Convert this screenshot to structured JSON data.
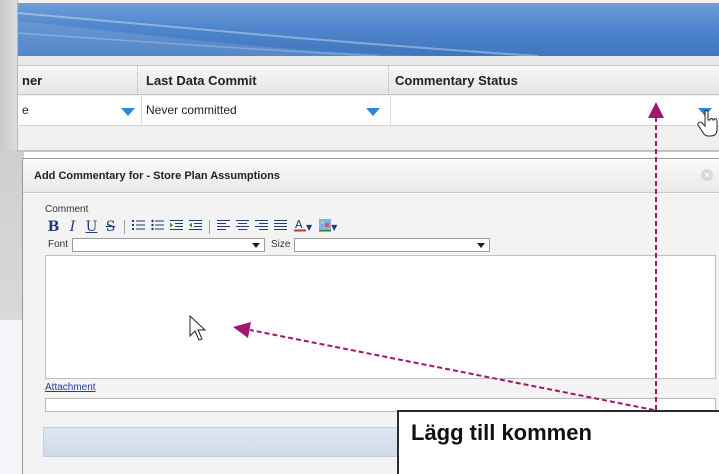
{
  "grid": {
    "columns": [
      "ner",
      "Last Data Commit",
      "Commentary Status"
    ],
    "row": [
      "e",
      "Never committed",
      ""
    ]
  },
  "dialog": {
    "title": "Add Commentary for - Store Plan Assumptions",
    "close_icon": "close-icon",
    "comment_label": "Comment",
    "toolbar": {
      "bold": "B",
      "italic": "I",
      "underline": "U",
      "strike": "S",
      "icons": [
        "ordered-list-icon",
        "unordered-list-icon",
        "indent-icon",
        "outdent-icon",
        "align-left-icon",
        "align-center-icon",
        "align-right-icon",
        "justify-icon",
        "font-color-icon",
        "highlight-color-icon"
      ]
    },
    "font_label": "Font",
    "font_value": "",
    "size_label": "Size",
    "size_value": "",
    "attachment_label": "Attachment"
  },
  "callout": {
    "text": "Lägg till kommen"
  },
  "colors": {
    "banner_blue": "#4f86cc",
    "dropdown_arrow": "#2e86d6",
    "annotation_arrow": "#a0176e",
    "link": "#1a3fa8"
  }
}
